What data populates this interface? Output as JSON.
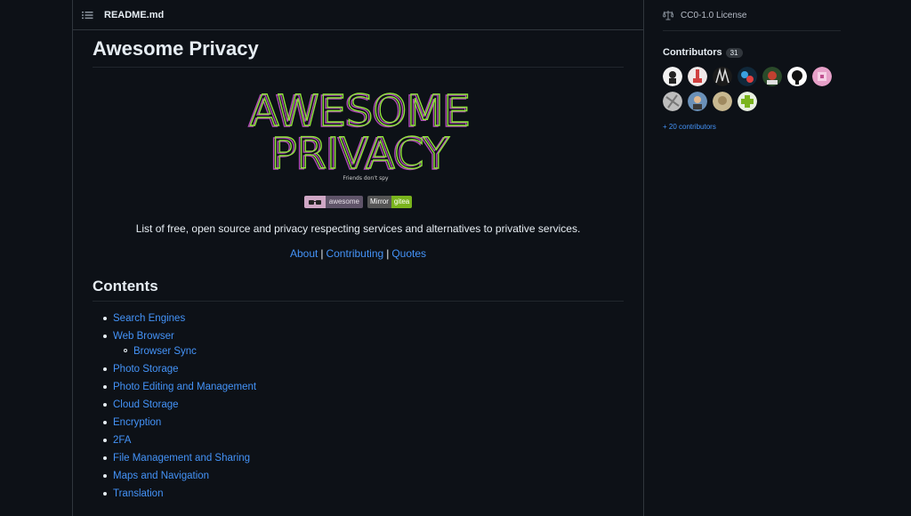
{
  "readme": {
    "filename": "README.md",
    "title": "Awesome Privacy",
    "logo": {
      "line1": "AWESOME",
      "line2": "PRIVACY",
      "tagline": "Friends don't spy"
    },
    "badges": {
      "awesome": {
        "label": "awesome"
      },
      "mirror": {
        "left": "Mirror",
        "right": "gitea"
      }
    },
    "description": "List of free, open source and privacy respecting services and alternatives to privative services.",
    "links": [
      {
        "label": "About"
      },
      {
        "label": "Contributing"
      },
      {
        "label": "Quotes"
      }
    ],
    "separator": "|",
    "contents_heading": "Contents",
    "toc": [
      {
        "label": "Search Engines"
      },
      {
        "label": "Web Browser",
        "sub": "Browser Sync"
      },
      {
        "label": "Photo Storage"
      },
      {
        "label": "Photo Editing and Management"
      },
      {
        "label": "Cloud Storage"
      },
      {
        "label": "Encryption"
      },
      {
        "label": "2FA"
      },
      {
        "label": "File Management and Sharing"
      },
      {
        "label": "Maps and Navigation"
      },
      {
        "label": "Translation"
      }
    ]
  },
  "sidebar": {
    "license": "CC0-1.0 License",
    "contributors_label": "Contributors",
    "contributors_count": "31",
    "avatar_colors": [
      "#e8e8e8",
      "#e0e0e0",
      "#2a2a2a",
      "#1b3a4a",
      "#3a6a3a",
      "#ffffff",
      "#e6a0c8",
      "#cfcfcf",
      "#7aa0c0",
      "#c8b890",
      "#8cc84a"
    ],
    "more_contributors": "+ 20 contributors"
  },
  "colors": {
    "background": "#0d1117",
    "link": "#4493f8",
    "logo_green": "#8ee23a",
    "logo_purple": "#b04ab8"
  }
}
